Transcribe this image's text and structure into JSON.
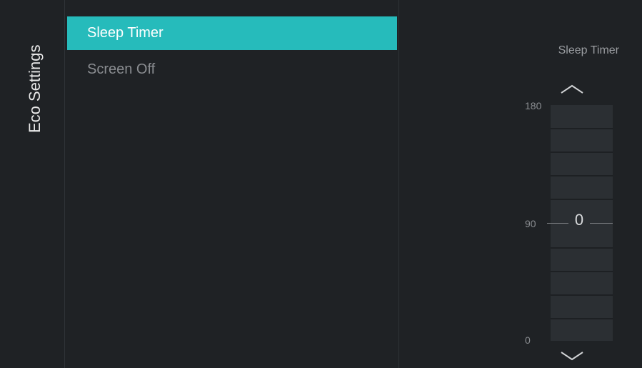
{
  "sidebar": {
    "title": "Eco Settings"
  },
  "menu": {
    "items": [
      {
        "label": "Sleep Timer",
        "selected": true
      },
      {
        "label": "Screen Off",
        "selected": false
      }
    ]
  },
  "panel": {
    "title": "Sleep Timer",
    "slider": {
      "max_label": "180",
      "mid_label": "90",
      "min_label": "0",
      "value": "0"
    },
    "up_icon": "chevron-up-icon",
    "down_icon": "chevron-down-icon"
  },
  "colors": {
    "background": "#1f2225",
    "accent": "#26bbbb",
    "text_primary": "#ffffff",
    "text_muted": "#8a8d91"
  }
}
